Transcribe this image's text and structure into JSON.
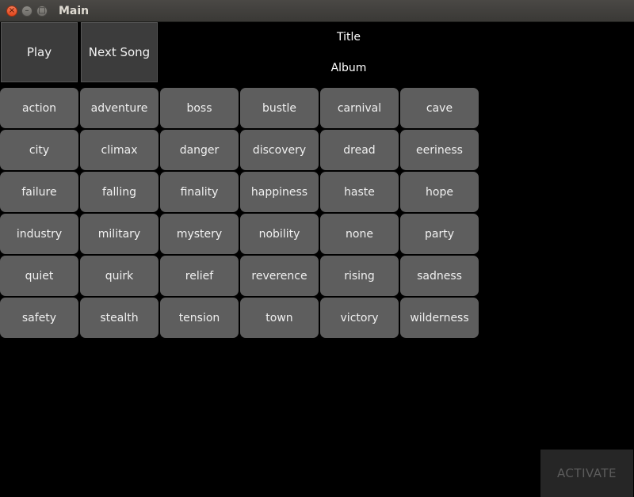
{
  "window": {
    "title": "Main",
    "close_glyph": "×",
    "minimize_glyph": "–",
    "maximize_glyph": "□"
  },
  "controls": {
    "play_label": "Play",
    "next_label": "Next Song"
  },
  "now_playing": {
    "title": "Title",
    "album": "Album"
  },
  "moods": [
    [
      "action",
      "adventure",
      "boss",
      "bustle",
      "carnival",
      "cave"
    ],
    [
      "city",
      "climax",
      "danger",
      "discovery",
      "dread",
      "eeriness"
    ],
    [
      "failure",
      "falling",
      "finality",
      "happiness",
      "haste",
      "hope"
    ],
    [
      "industry",
      "military",
      "mystery",
      "nobility",
      "none",
      "party"
    ],
    [
      "quiet",
      "quirk",
      "relief",
      "reverence",
      "rising",
      "sadness"
    ],
    [
      "safety",
      "stealth",
      "tension",
      "town",
      "victory",
      "wilderness"
    ]
  ],
  "activate_label": "ACTIVATE",
  "colors": {
    "background": "#000000",
    "mood_button": "#5e5e5e",
    "activate_disabled_text": "#5c5c5c"
  }
}
